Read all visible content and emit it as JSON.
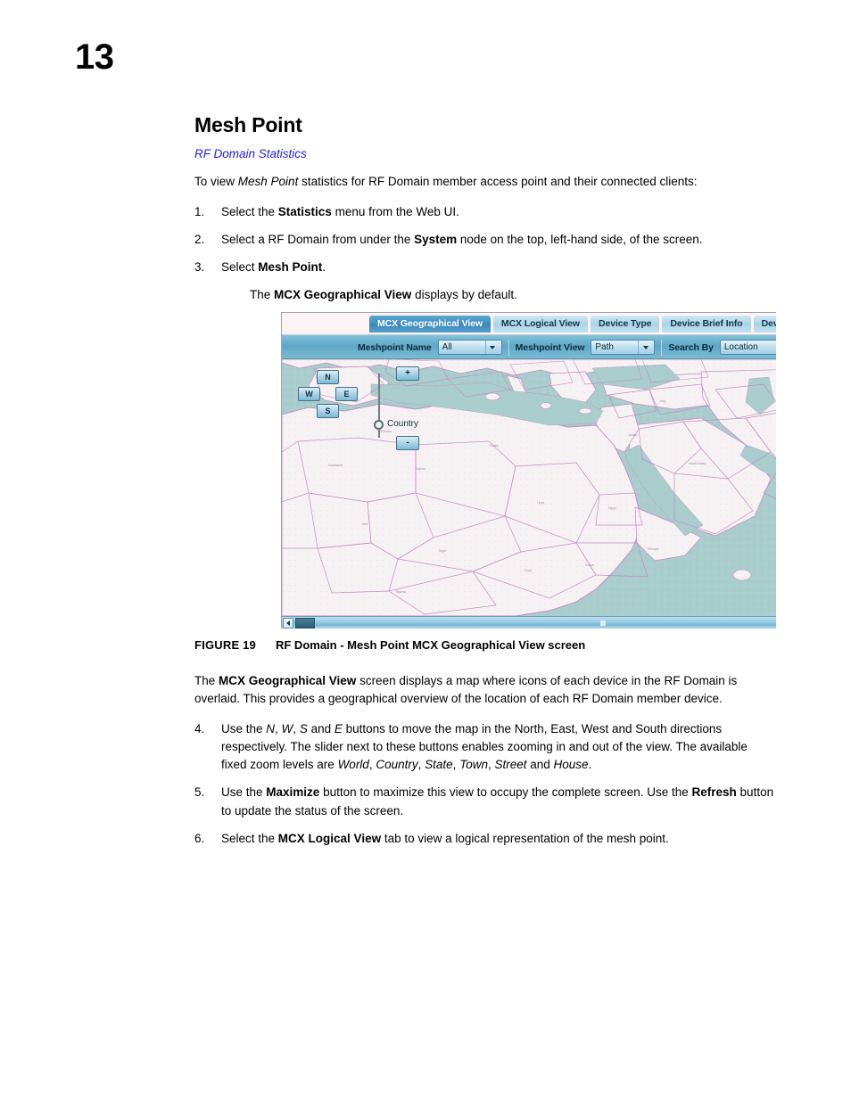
{
  "page": {
    "chapter_number": "13",
    "title": "Mesh Point",
    "xref": "RF Domain Statistics",
    "intro": {
      "pre": "To view ",
      "em": "Mesh Point",
      "post": " statistics for RF Domain member access point and their connected clients:"
    },
    "steps_top": [
      {
        "num": "1.",
        "pre": "Select the ",
        "strong": "Statistics",
        "post": " menu from the Web UI."
      },
      {
        "num": "2.",
        "pre": "Select a RF Domain from under the ",
        "strong": "System",
        "post": " node on the top, left-hand side, of the screen."
      },
      {
        "num": "3.",
        "pre": "Select ",
        "strong": "Mesh Point",
        "post": "."
      }
    ],
    "sub_note": {
      "pre": "The ",
      "strong": "MCX Geographical View",
      "post": " displays by default."
    },
    "figure_caption": {
      "label": "FIGURE 19",
      "text": "RF Domain - Mesh Point MCX Geographical View screen"
    },
    "paragraph_after_figure": {
      "pre": "The ",
      "strong": "MCX Geographical View",
      "post": " screen displays a map where icons of each device in the RF Domain is overlaid. This provides a geographical overview of the location of each RF Domain member device."
    },
    "steps_bottom": [
      {
        "num": "4.",
        "text": "Use the N, W, S and E buttons to move the map in the North, East, West and South directions respectively. The slider next to these buttons enables zooming in and out of the view. The available fixed zoom levels are World, Country, State, Town, Street and House."
      },
      {
        "num": "5.",
        "pre": "Use the ",
        "strong1": "Maximize",
        "mid": " button to maximize this view to occupy the complete screen. Use the ",
        "strong2": "Refresh",
        "post": " button to update the status of the screen."
      },
      {
        "num": "6.",
        "pre": "Select the ",
        "strong": "MCX Logical View",
        "post": " tab to view a logical representation of the mesh point."
      }
    ]
  },
  "screenshot": {
    "tabs": [
      {
        "label": "MCX Geographical View",
        "active": true
      },
      {
        "label": "MCX Logical View",
        "active": false
      },
      {
        "label": "Device Type",
        "active": false
      },
      {
        "label": "Device Brief Info",
        "active": false
      },
      {
        "label": "Device Da",
        "active": false
      }
    ],
    "filter_bar": {
      "meshpoint_name_label": "Meshpoint Name",
      "meshpoint_name_value": "All",
      "meshpoint_view_label": "Meshpoint View",
      "meshpoint_view_value": "Path",
      "search_by_label": "Search By",
      "search_by_value": "Location",
      "search_input_value": ""
    },
    "map_controls": {
      "north": "N",
      "west": "W",
      "east": "E",
      "south": "S",
      "zoom_in": "+",
      "zoom_out": "-",
      "zoom_level": "Country"
    },
    "colors": {
      "active_tab": "#3d88bb",
      "inactive_tab": "#aad4e8",
      "filter_bar": "#5fa7c6",
      "map_water": "#a9cdcd",
      "map_land": "#f6f1f2",
      "map_border": "#c389c3",
      "scrollbar": "#8cc4de"
    }
  }
}
